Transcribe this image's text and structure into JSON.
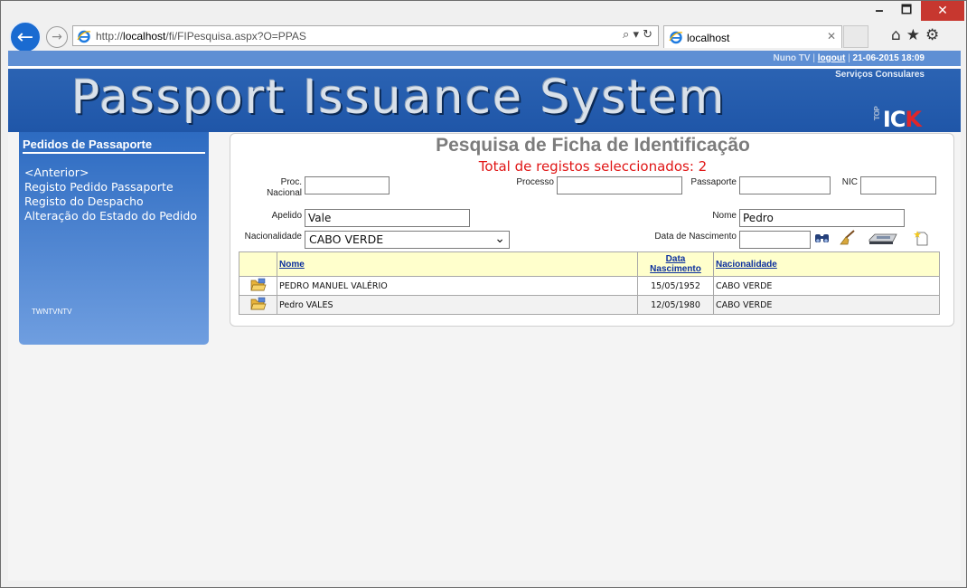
{
  "browser": {
    "url_prefix": "http://",
    "url_host": "localhost",
    "url_path": "/fi/FIPesquisa.aspx?O=PPAS",
    "tab_title": "localhost",
    "window_controls": {
      "minimize": "🗕",
      "maximize": "🗖",
      "close": "✕"
    },
    "address_controls": "⌕ ▾ ↻",
    "tab_close": "✕",
    "back_glyph": "←",
    "forward_glyph": "→",
    "tools_glyphs": "⌂★⚙"
  },
  "header": {
    "user": "Nuno TV",
    "logout": "logout",
    "datetime": "21-06-2015 18:09",
    "separator": "|",
    "subtitle": "Serviços Consulares",
    "title": "Passport Issuance System",
    "logo_top": "TOP",
    "logo_ic": "IC",
    "logo_k": "K"
  },
  "sidebar": {
    "heading": "Pedidos de Passaporte",
    "items": [
      {
        "label": "<Anterior>"
      },
      {
        "label": "Registo Pedido Passaporte"
      },
      {
        "label": "Registo do Despacho"
      },
      {
        "label": "Alteração do Estado do Pedido"
      }
    ],
    "footer_text": "TWNTVNTV"
  },
  "main": {
    "title": "Pesquisa de Ficha de Identificação",
    "count_text": "Total de registos seleccionados: 2",
    "form": {
      "proc_nacional_label_1": "Proc.",
      "proc_nacional_label_2": "Nacional",
      "proc_nacional_value": "",
      "processo_label": "Processo",
      "processo_value": "",
      "passaporte_label": "Passaporte",
      "passaporte_value": "",
      "nic_label": "NIC",
      "nic_value": "",
      "apelido_label": "Apelido",
      "apelido_value": "Vale",
      "nome_label": "Nome",
      "nome_value": "Pedro",
      "nacionalidade_label": "Nacionalidade",
      "nacionalidade_value": "CABO VERDE",
      "data_nascimento_label": "Data de Nascimento",
      "data_nascimento_value": ""
    },
    "table": {
      "headers": {
        "nome": "Nome",
        "data_1": "Data",
        "data_2": "Nascimento",
        "nacionalidade": "Nacionalidade"
      },
      "rows": [
        {
          "nome": "PEDRO MANUEL VALÉRIO",
          "data": "15/05/1952",
          "nacionalidade": "CABO VERDE"
        },
        {
          "nome": "Pedro VALES",
          "data": "12/05/1980",
          "nacionalidade": "CABO VERDE"
        }
      ]
    }
  },
  "colors": {
    "brand_blue": "#2b63b3",
    "top_bar": "#5e8fd4",
    "count_red": "#e01616",
    "header_yellow": "#ffffcc",
    "link_blue": "#0b2f9e"
  }
}
